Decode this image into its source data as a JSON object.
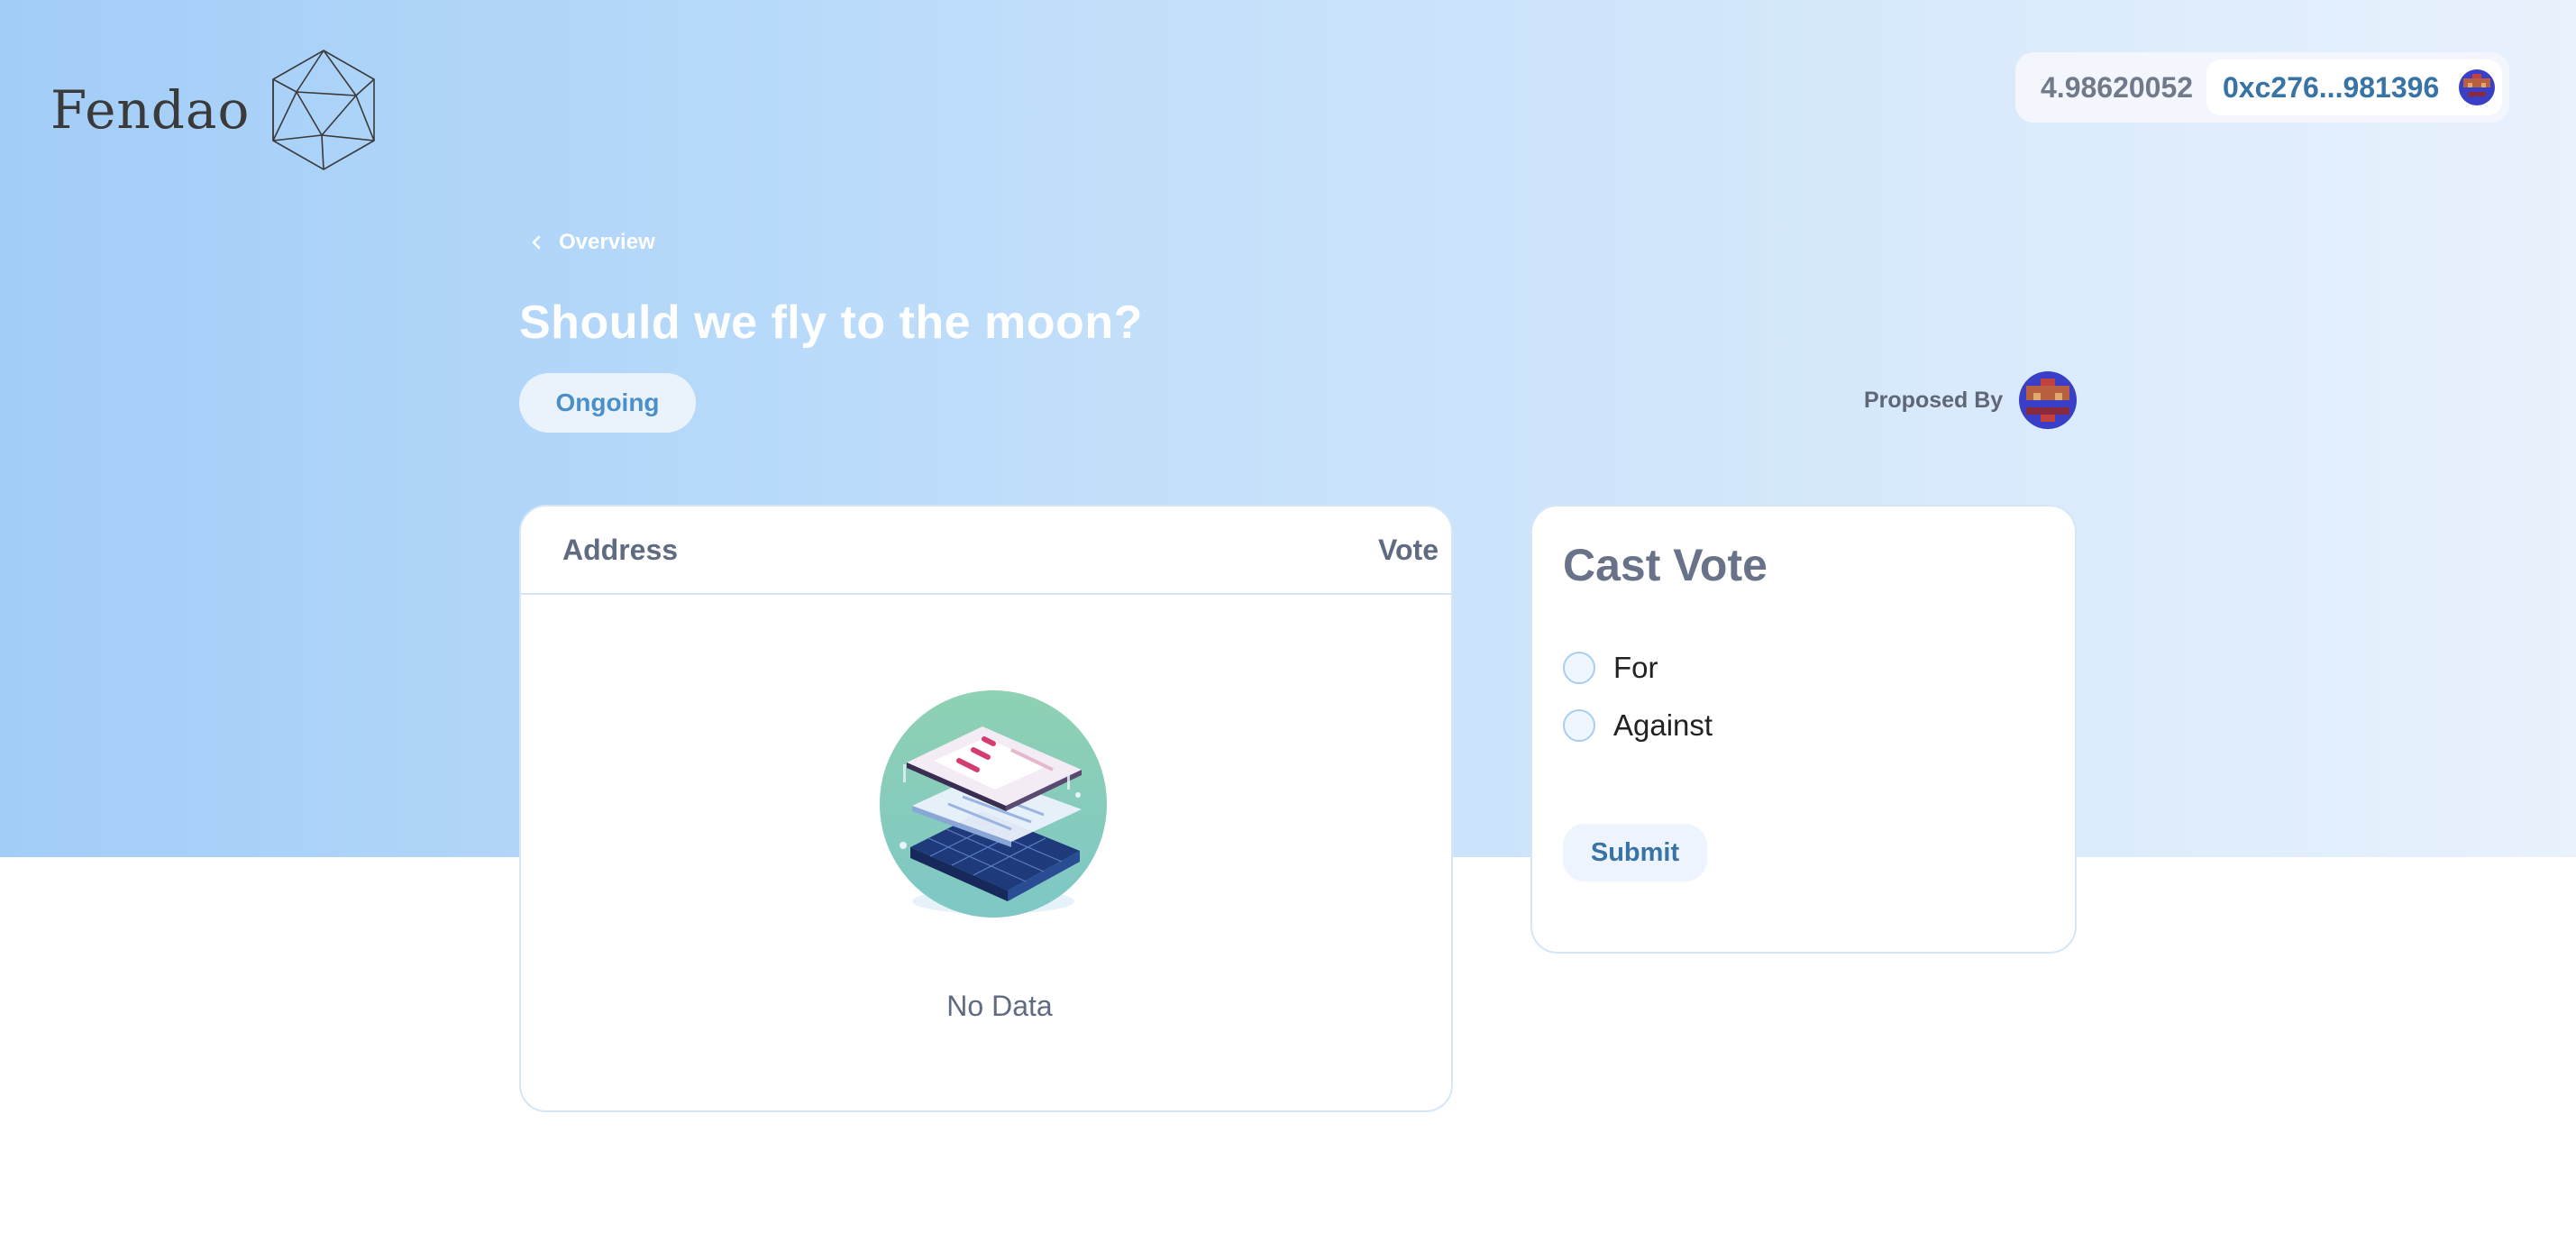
{
  "brand": {
    "name": "Fendao"
  },
  "wallet": {
    "balance": "4.98620052",
    "address": "0xc276...981396"
  },
  "breadcrumb": {
    "label": "Overview"
  },
  "proposal": {
    "title": "Should we fly to the moon?",
    "status": "Ongoing",
    "proposed_by_label": "Proposed By"
  },
  "votes_table": {
    "columns": [
      "Address",
      "Vote"
    ],
    "rows": [],
    "empty_text": "No Data"
  },
  "cast_vote": {
    "title": "Cast Vote",
    "options": [
      "For",
      "Against"
    ],
    "submit_label": "Submit"
  },
  "colors": {
    "hero_gradient_start": "#a2cdf7",
    "hero_gradient_end": "#e9f2fd",
    "accent": "#3873a6",
    "status_text": "#4b8fc8"
  }
}
